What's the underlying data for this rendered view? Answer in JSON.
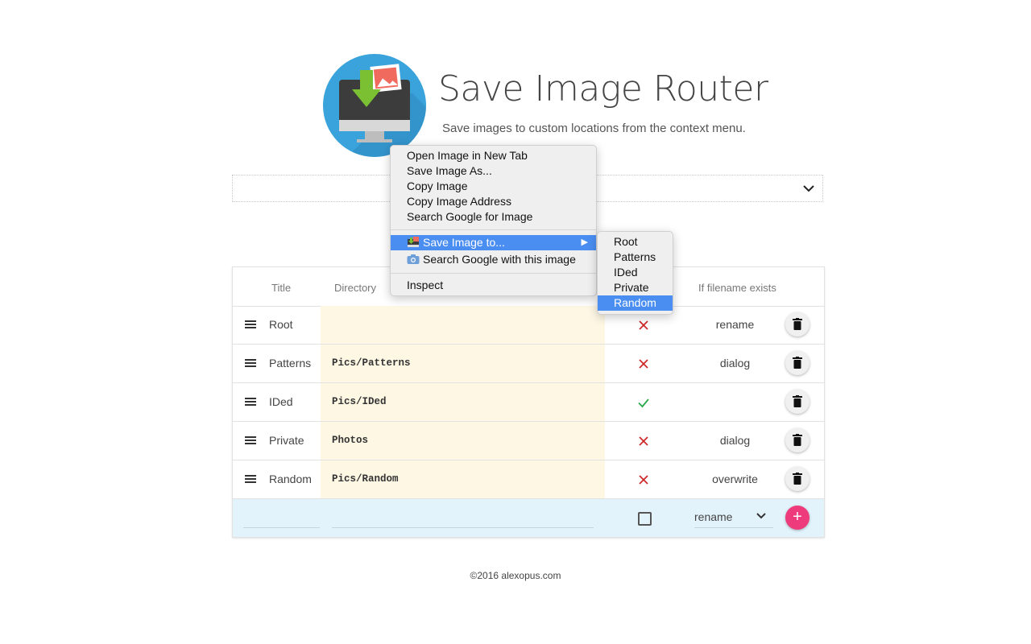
{
  "header": {
    "title": "Save Image Router",
    "subtitle": "Save images to custom locations from the context menu."
  },
  "profile_select": {
    "value": ""
  },
  "table": {
    "columns": [
      "Title",
      "Directory",
      "If filename exists"
    ],
    "rows": [
      {
        "title": "Root",
        "directory": "",
        "prompt": false,
        "exists": "rename"
      },
      {
        "title": "Patterns",
        "directory": "Pics/Patterns",
        "prompt": false,
        "exists": "dialog"
      },
      {
        "title": "IDed",
        "directory": "Pics/IDed",
        "prompt": true,
        "exists": ""
      },
      {
        "title": "Private",
        "directory": "Photos",
        "prompt": false,
        "exists": "dialog"
      },
      {
        "title": "Random",
        "directory": "Pics/Random",
        "prompt": false,
        "exists": "overwrite"
      }
    ],
    "new_row": {
      "title": "",
      "directory": "",
      "prompt": false,
      "exists": "rename",
      "add": "+"
    }
  },
  "footer": "©2016 alexopus.com",
  "context_menu": {
    "items": [
      "Open Image in New Tab",
      "Save Image As...",
      "Copy Image",
      "Copy Image Address",
      "Search Google for Image"
    ],
    "save_to": "Save Image to...",
    "search_with": "Search Google with this image",
    "inspect": "Inspect",
    "arrow": "▶",
    "submenu": [
      "Root",
      "Patterns",
      "IDed",
      "Private",
      "Random"
    ],
    "highlight_color": "#4a8ef1"
  },
  "colors": {
    "accent": "#ee3b7b",
    "logo": "#3aa3db",
    "dir_bg": "#fdf7e4",
    "add_row_bg": "#e3f3fc",
    "cross": "#cc2b2b",
    "check": "#2aa84a"
  }
}
